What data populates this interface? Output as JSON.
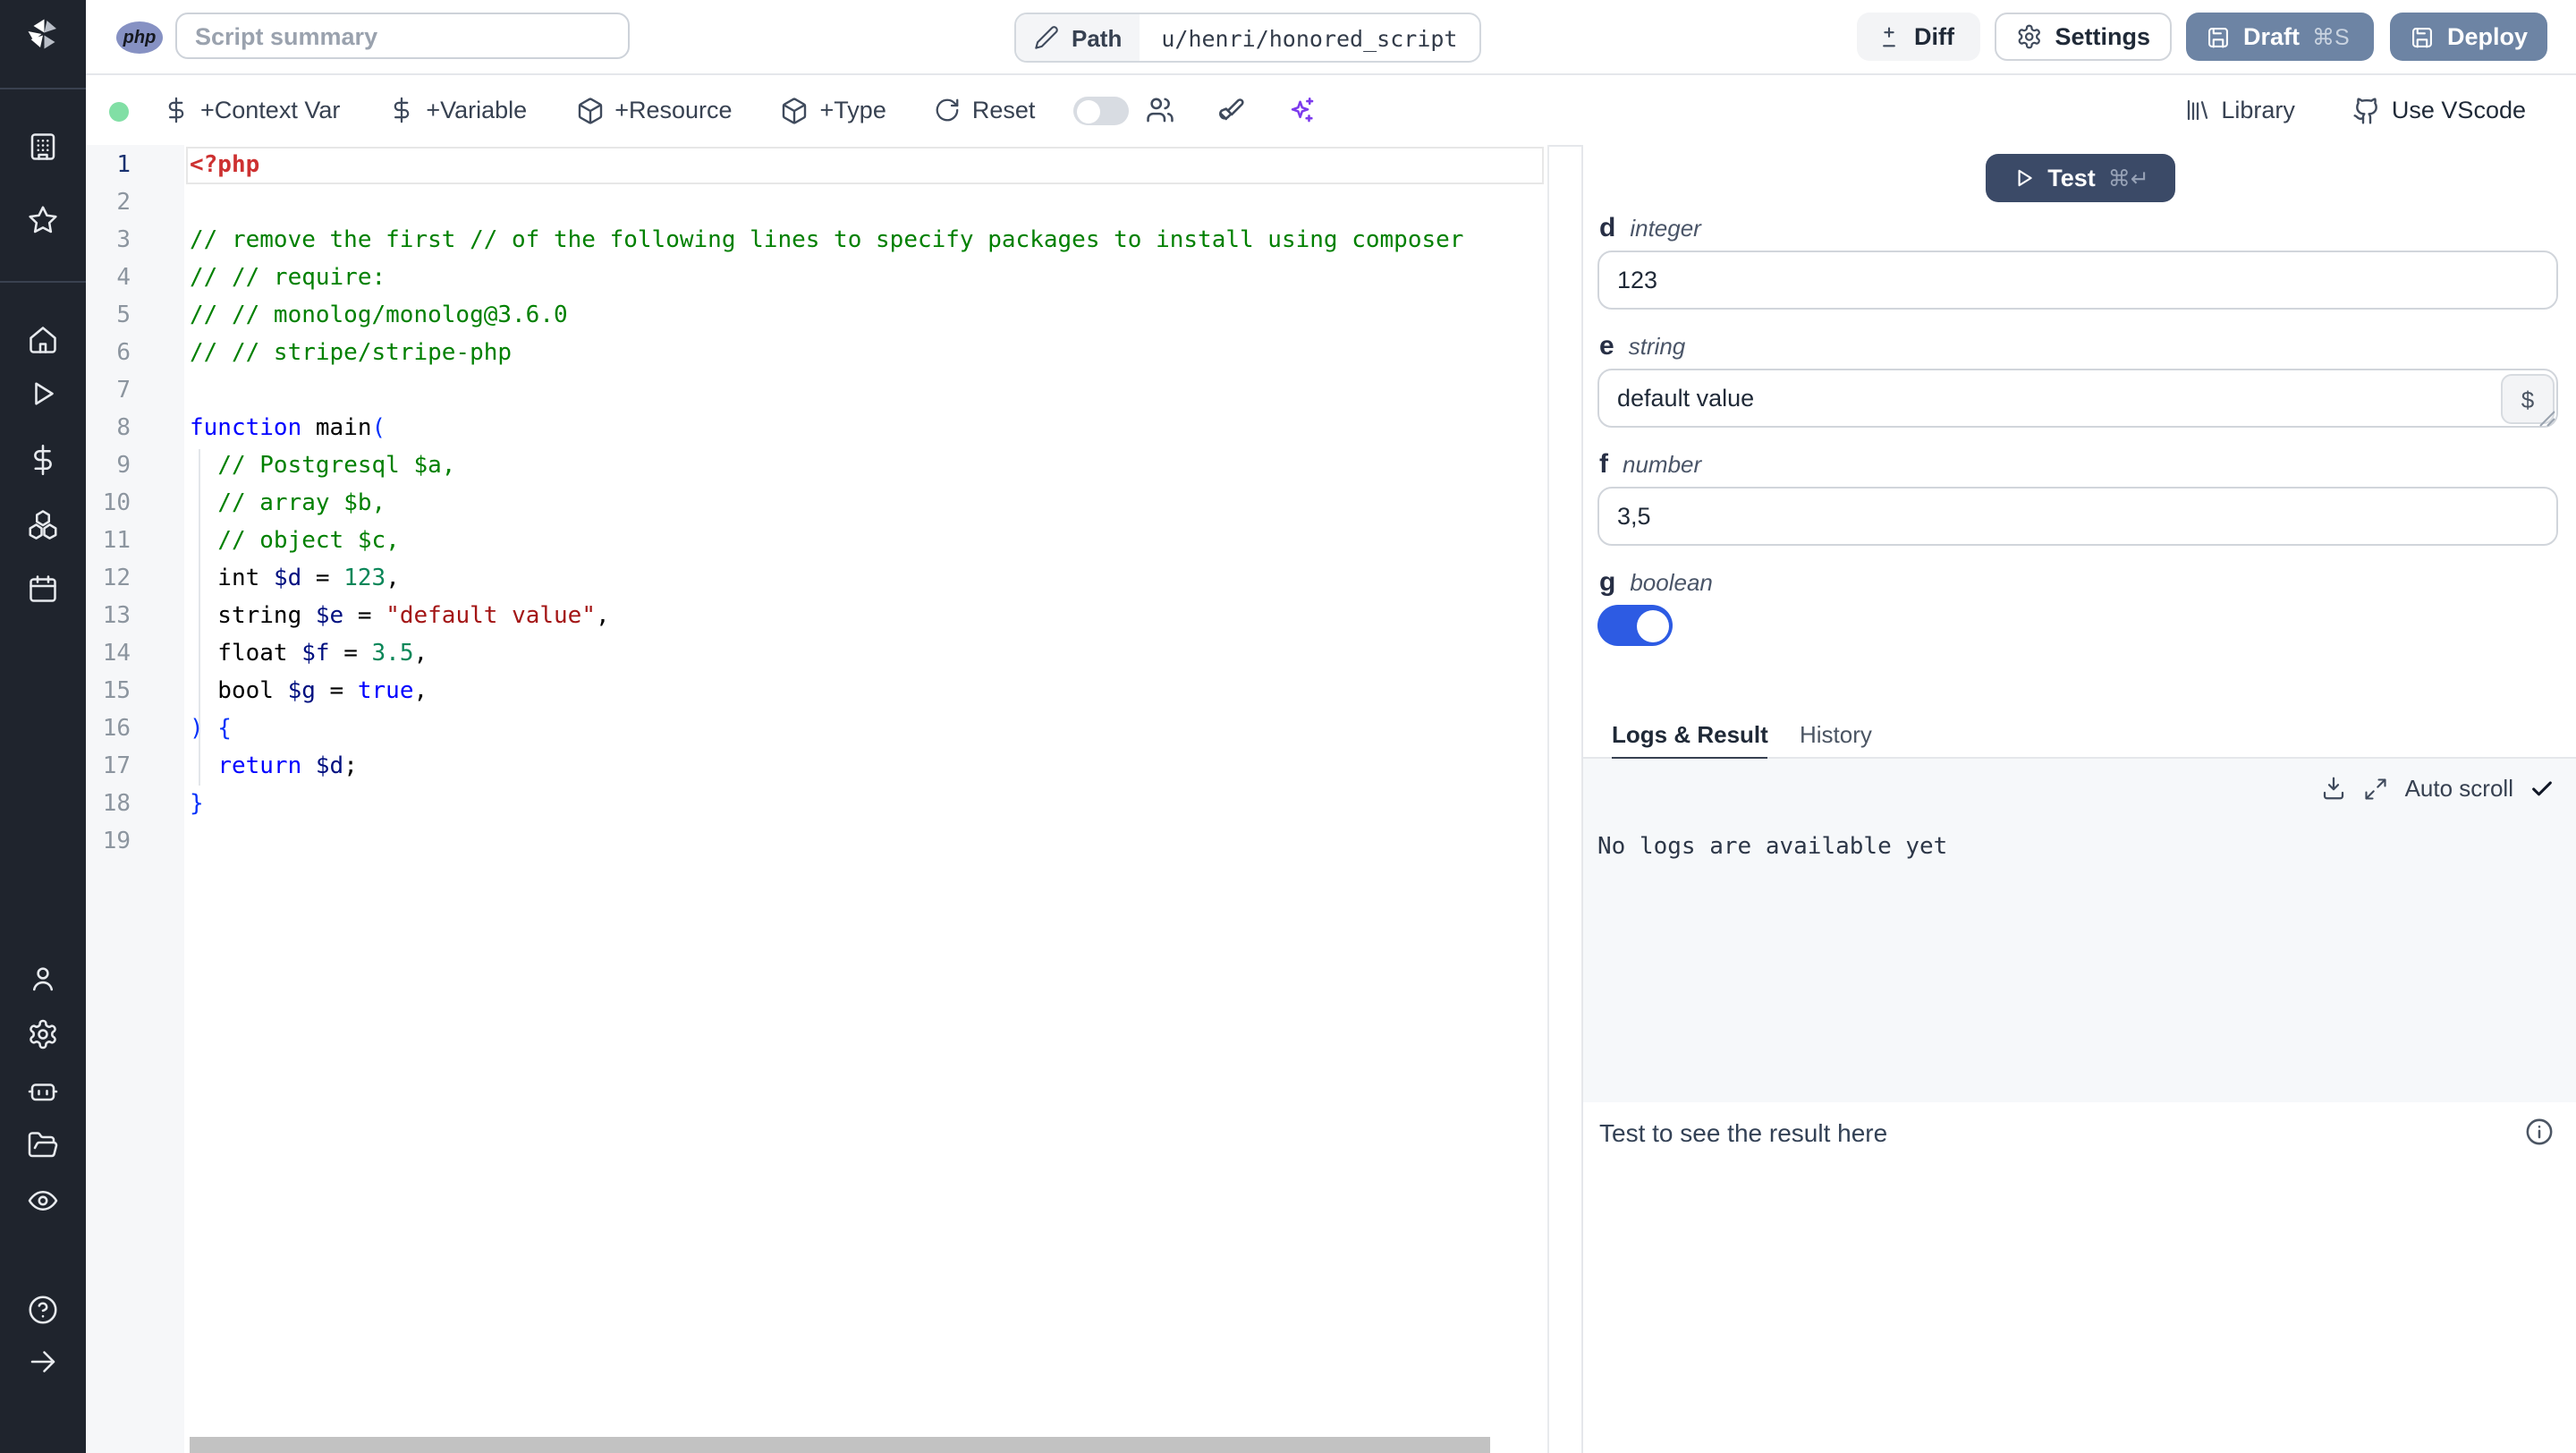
{
  "app": {
    "language_badge": "php"
  },
  "topbar": {
    "summary_placeholder": "Script summary",
    "path_label": "Path",
    "path_value": "u/henri/honored_script",
    "diff_label": "Diff",
    "settings_label": "Settings",
    "draft_label": "Draft",
    "draft_shortcut": "⌘S",
    "deploy_label": "Deploy"
  },
  "toolbar": {
    "context_var_label": "+Context Var",
    "variable_label": "+Variable",
    "resource_label": "+Resource",
    "type_label": "+Type",
    "reset_label": "Reset",
    "library_label": "Library",
    "vscode_label": "Use VScode"
  },
  "sidebar": {
    "icons": [
      "windmill-logo",
      "workspace",
      "favorites",
      "home",
      "runs",
      "variables",
      "resources",
      "schedules",
      "user",
      "settings",
      "workers",
      "folders",
      "audit-logs",
      "help",
      "expand"
    ]
  },
  "editor": {
    "language": "php",
    "lines": [
      {
        "n": 1,
        "active": true,
        "tokens": [
          {
            "t": "<?php",
            "c": "meta"
          }
        ]
      },
      {
        "n": 2,
        "tokens": []
      },
      {
        "n": 3,
        "tokens": [
          {
            "t": "// remove the first // of the following lines to specify packages to install using composer",
            "c": "comment"
          }
        ]
      },
      {
        "n": 4,
        "tokens": [
          {
            "t": "// // require:",
            "c": "comment"
          }
        ]
      },
      {
        "n": 5,
        "tokens": [
          {
            "t": "// // monolog/monolog@3.6.0",
            "c": "comment"
          }
        ]
      },
      {
        "n": 6,
        "tokens": [
          {
            "t": "// // stripe/stripe-php",
            "c": "comment"
          }
        ]
      },
      {
        "n": 7,
        "tokens": []
      },
      {
        "n": 8,
        "tokens": [
          {
            "t": "function",
            "c": "kw"
          },
          {
            "t": " main",
            "c": "plain"
          },
          {
            "t": "(",
            "c": "br"
          }
        ]
      },
      {
        "n": 9,
        "tokens": [
          {
            "t": "  ",
            "c": "plain"
          },
          {
            "t": "// Postgresql $a,",
            "c": "comment"
          }
        ]
      },
      {
        "n": 10,
        "tokens": [
          {
            "t": "  ",
            "c": "plain"
          },
          {
            "t": "// array $b,",
            "c": "comment"
          }
        ]
      },
      {
        "n": 11,
        "tokens": [
          {
            "t": "  ",
            "c": "plain"
          },
          {
            "t": "// object $c,",
            "c": "comment"
          }
        ]
      },
      {
        "n": 12,
        "tokens": [
          {
            "t": "  int ",
            "c": "plain"
          },
          {
            "t": "$d",
            "c": "var"
          },
          {
            "t": " = ",
            "c": "plain"
          },
          {
            "t": "123",
            "c": "num"
          },
          {
            "t": ",",
            "c": "plain"
          }
        ]
      },
      {
        "n": 13,
        "tokens": [
          {
            "t": "  string ",
            "c": "plain"
          },
          {
            "t": "$e",
            "c": "var"
          },
          {
            "t": " = ",
            "c": "plain"
          },
          {
            "t": "\"default value\"",
            "c": "str"
          },
          {
            "t": ",",
            "c": "plain"
          }
        ]
      },
      {
        "n": 14,
        "tokens": [
          {
            "t": "  float ",
            "c": "plain"
          },
          {
            "t": "$f",
            "c": "var"
          },
          {
            "t": " = ",
            "c": "plain"
          },
          {
            "t": "3.5",
            "c": "num"
          },
          {
            "t": ",",
            "c": "plain"
          }
        ]
      },
      {
        "n": 15,
        "tokens": [
          {
            "t": "  bool ",
            "c": "plain"
          },
          {
            "t": "$g",
            "c": "var"
          },
          {
            "t": " = ",
            "c": "plain"
          },
          {
            "t": "true",
            "c": "kw"
          },
          {
            "t": ",",
            "c": "plain"
          }
        ]
      },
      {
        "n": 16,
        "tokens": [
          {
            "t": ") {",
            "c": "br"
          }
        ]
      },
      {
        "n": 17,
        "tokens": [
          {
            "t": "  ",
            "c": "plain"
          },
          {
            "t": "return",
            "c": "kw"
          },
          {
            "t": " ",
            "c": "plain"
          },
          {
            "t": "$d",
            "c": "var"
          },
          {
            "t": ";",
            "c": "plain"
          }
        ]
      },
      {
        "n": 18,
        "tokens": [
          {
            "t": "}",
            "c": "br"
          }
        ]
      },
      {
        "n": 19,
        "tokens": []
      }
    ]
  },
  "right_panel": {
    "test_button": {
      "label": "Test",
      "shortcut": "⌘↵"
    },
    "fields": [
      {
        "name": "d",
        "type": "integer",
        "value": "123"
      },
      {
        "name": "e",
        "type": "string",
        "value": "default value",
        "dollar_button": "$"
      },
      {
        "name": "f",
        "type": "number",
        "value": "3,5"
      },
      {
        "name": "g",
        "type": "boolean",
        "value": "on"
      }
    ],
    "tabs": [
      {
        "label": "Logs & Result",
        "active": true
      },
      {
        "label": "History",
        "active": false
      }
    ],
    "logs": {
      "auto_scroll_label": "Auto scroll",
      "empty_message": "No logs are available yet"
    },
    "result_placeholder": "Test to see the result here"
  },
  "colors": {
    "sidebar_bg": "#1f242d",
    "slate_button": "#6d84a4",
    "test_button": "#3b4a67",
    "toggle_on": "#2d5be3",
    "status_dot": "#81dfa5",
    "sparkles": "#7c3aed",
    "php_badge": "#8691c3"
  }
}
